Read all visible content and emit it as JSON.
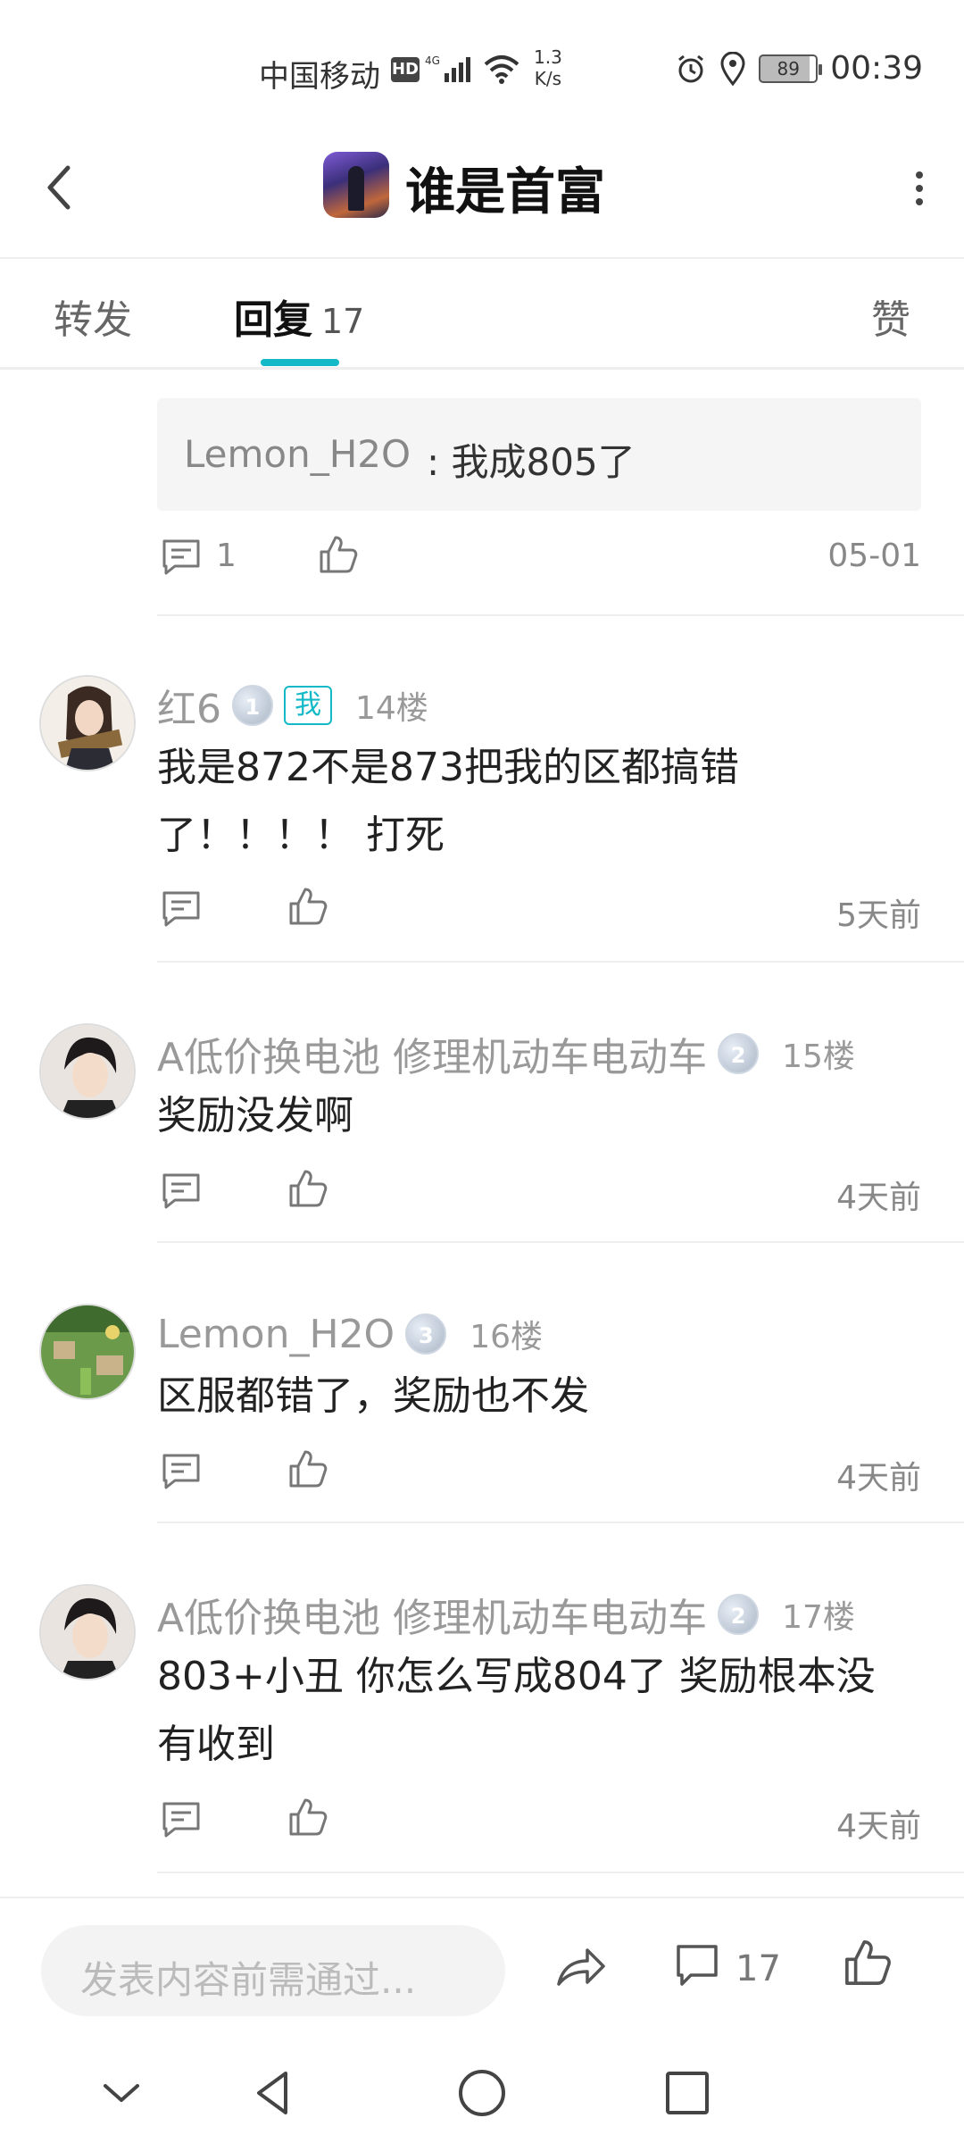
{
  "status_bar": {
    "carrier": "中国移动",
    "hd": "HD",
    "net_speed_value": "1.3",
    "net_speed_unit": "K/s",
    "battery": "89",
    "time": "00:39"
  },
  "header": {
    "title": "谁是首富"
  },
  "tabs": {
    "forward": "转发",
    "reply": "回复",
    "reply_count": "17",
    "like": "赞"
  },
  "quote": {
    "name": "Lemon_H2O",
    "text": ": 我成805了",
    "comment_count": "1",
    "time": "05-01"
  },
  "comments": [
    {
      "name": "红6",
      "level": "1",
      "badge": "我",
      "floor": "14楼",
      "text_line1": "我是872不是873把我的区都搞错",
      "text_line2": "了！！！！ 打死",
      "time": "5天前"
    },
    {
      "name": "A低价换电池 修理机动车电动车",
      "level": "2",
      "floor": "15楼",
      "text_line1": "奖励没发啊",
      "time": "4天前"
    },
    {
      "name": "Lemon_H2O",
      "level": "3",
      "floor": "16楼",
      "text_line1": "区服都错了，奖励也不发",
      "time": "4天前"
    },
    {
      "name": "A低价换电池 修理机动车电动车",
      "level": "2",
      "floor": "17楼",
      "text_line1": "803+小丑 你怎么写成804了  奖励根本没",
      "text_line2": "有收到",
      "time": "4天前"
    }
  ],
  "bottom_bar": {
    "input_placeholder": "发表内容前需通过...",
    "comment_count": "17"
  },
  "colors": {
    "accent": "#14b9c8",
    "muted_text": "#888888"
  }
}
